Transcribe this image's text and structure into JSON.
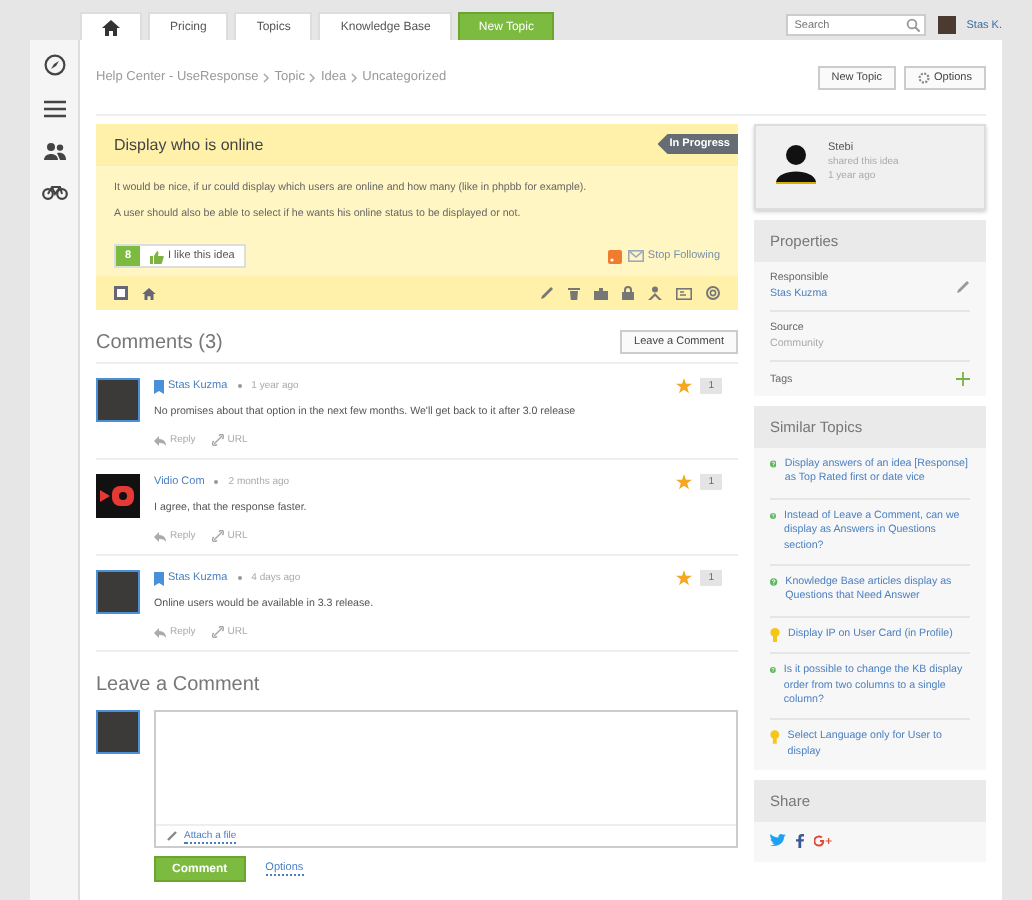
{
  "nav": {
    "tabs": [
      {
        "kind": "home"
      },
      {
        "kind": "link",
        "label": "Pricing"
      },
      {
        "kind": "link",
        "label": "Topics"
      },
      {
        "kind": "link",
        "label": "Knowledge Base"
      },
      {
        "kind": "action",
        "label": "New Topic"
      }
    ],
    "search": {
      "placeholder": "Search"
    },
    "user": "Stas K."
  },
  "breadcrumb": [
    "Help Center - UseResponse",
    "Topic",
    "Idea",
    "Uncategorized"
  ],
  "header_buttons": [
    "New Topic",
    "Options"
  ],
  "topic": {
    "title": "Display who is online",
    "status": "In Progress",
    "paragraphs": [
      "It would be nice, if ur could display which users are online and how many (like in phpbb for example).",
      "A user should also be able to select if he wants his online status to be displayed or not."
    ],
    "likes": "8",
    "like_label": "I like this idea",
    "follow_label": "Stop Following"
  },
  "comments_title": "Comments (3)",
  "leave_button": "Leave a Comment",
  "comments": [
    {
      "kind": "photo",
      "author": "Stas Kuzma",
      "staff": true,
      "time": "1 year ago",
      "text": "No promises about that option in the next few months. We'll get back to it after 3.0 release",
      "votes": "1",
      "reply": "Reply",
      "url": "URL"
    },
    {
      "kind": "video",
      "author": "Vidio Com",
      "staff": false,
      "time": "2 months ago",
      "text": "I agree, that the response faster.",
      "votes": "1",
      "reply": "Reply",
      "url": "URL"
    },
    {
      "kind": "photo",
      "author": "Stas Kuzma",
      "staff": true,
      "time": "4 days ago",
      "text": "Online users would be available in 3.3 release.",
      "votes": "1",
      "reply": "Reply",
      "url": "URL"
    }
  ],
  "compose": {
    "title": "Leave a Comment",
    "attach": "Attach a file",
    "submit": "Comment",
    "options": "Options"
  },
  "author_card": {
    "name": "Stebi",
    "action": "shared this idea",
    "time": "1 year ago"
  },
  "properties": {
    "title": "Properties",
    "items": [
      {
        "kind": "edit",
        "label": "Responsible",
        "value": "Stas Kuzma",
        "link": true
      },
      {
        "kind": "plain",
        "label": "Source",
        "value": "Community",
        "link": false
      },
      {
        "kind": "add",
        "label": "Tags"
      }
    ]
  },
  "similar": {
    "title": "Similar Topics",
    "items": [
      {
        "kind": "question",
        "text": "Display answers of an idea [Response] as Top Rated first or date vice"
      },
      {
        "kind": "question",
        "text": "Instead of Leave a Comment, can we display as Answers in Questions section?"
      },
      {
        "kind": "question",
        "text": "Knowledge Base articles display as Questions that Need Answer"
      },
      {
        "kind": "idea",
        "text": "Display IP on User Card (in Profile)"
      },
      {
        "kind": "question",
        "text": "Is it possible to change the KB display order from two columns to a single column?"
      },
      {
        "kind": "idea",
        "text": "Select Language only for User to display"
      }
    ]
  },
  "share": {
    "title": "Share"
  }
}
